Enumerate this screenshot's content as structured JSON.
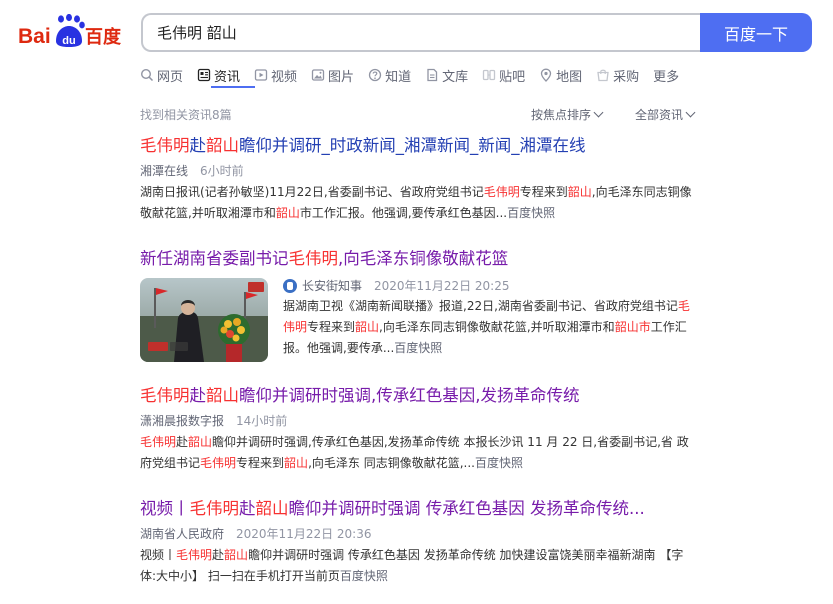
{
  "header": {
    "logo_text_left": "Bai",
    "logo_text_mid": "du",
    "logo_text_right": "百度",
    "search_value": "毛伟明 韶山",
    "search_button": "百度一下"
  },
  "tabs": [
    {
      "label": "网页",
      "icon": "search-icon"
    },
    {
      "label": "资讯",
      "icon": "news-icon"
    },
    {
      "label": "视频",
      "icon": "video-icon"
    },
    {
      "label": "图片",
      "icon": "image-icon"
    },
    {
      "label": "知道",
      "icon": "question-icon"
    },
    {
      "label": "文库",
      "icon": "document-icon"
    },
    {
      "label": "贴吧",
      "icon": "forum-icon"
    },
    {
      "label": "地图",
      "icon": "map-pin-icon"
    },
    {
      "label": "采购",
      "icon": "shopping-icon"
    },
    {
      "label": "更多",
      "icon": ""
    }
  ],
  "meta": {
    "result_count": "找到相关资讯8篇",
    "sort_label": "按焦点排序",
    "filter_label": "全部资讯"
  },
  "results": [
    {
      "title_parts": [
        "毛伟明",
        "赴",
        "韶山",
        "瞻仰并调研_时政新闻_湘潭新闻_新闻_湘潭在线"
      ],
      "source": "湘潭在线",
      "time": "6小时前",
      "abstract_parts": [
        "湖南日报讯(记者孙敏坚)11月22日,省委副书记、省政府党组书记",
        "毛伟明",
        "专程来到",
        "韶山",
        ",向毛泽东同志铜像敬献花篮,并听取湘潭市和",
        "韶山",
        "市工作汇报。他强调,要传承红色基因..."
      ],
      "kuaizhao": "百度快照"
    },
    {
      "title_parts": [
        "新任湖南省委副书记",
        "毛伟明",
        ",向毛泽东铜像敬献花篮"
      ],
      "source": "长安街知事",
      "time": "2020年11月22日 20:25",
      "abstract_parts": [
        "据湖南卫视《湖南新闻联播》报道,22日,湖南省委副书记、省政府党组书记",
        "毛伟明",
        "专程来到",
        "韶山",
        ",向毛泽东同志铜像敬献花篮,并听取湘潭市和",
        "韶山市",
        "工作汇报。他强调,要传承..."
      ],
      "kuaizhao": "百度快照"
    },
    {
      "title_parts": [
        "毛伟明",
        "赴",
        "韶山",
        "瞻仰并调研时强调,传承红色基因,发扬革命传统"
      ],
      "source": "潇湘晨报数字报",
      "time": "14小时前",
      "abstract_parts": [
        "毛伟明",
        "赴",
        "韶山",
        "瞻仰并调研时强调,传承红色基因,发扬革命传统 本报长沙讯 11 月 22 日,省委副书记,省 政府党组书记",
        "毛伟明",
        "专程来到",
        "韶山",
        ",向毛泽东 同志铜像敬献花篮,..."
      ],
      "kuaizhao": "百度快照"
    },
    {
      "title_parts": [
        "视频丨",
        "毛伟明",
        "赴",
        "韶山",
        "瞻仰并调研时强调 传承红色基因 发扬革命传统..."
      ],
      "source": "湖南省人民政府",
      "time": "2020年11月22日 20:36",
      "abstract_parts": [
        "视频丨",
        "毛伟明",
        "赴",
        "韶山",
        "瞻仰并调研时强调 传承红色基因 发扬革命传统 加快建设富饶美丽幸福新湖南 【字体:大中小】 扫一扫在手机打开当前页"
      ],
      "kuaizhao": "百度快照"
    }
  ],
  "colors": {
    "brand_red": "#de2910",
    "brand_blue": "#2932e1",
    "button": "#4e6ef2",
    "link": "#2440b3",
    "visited": "#771caa",
    "highlight": "#f73131"
  }
}
